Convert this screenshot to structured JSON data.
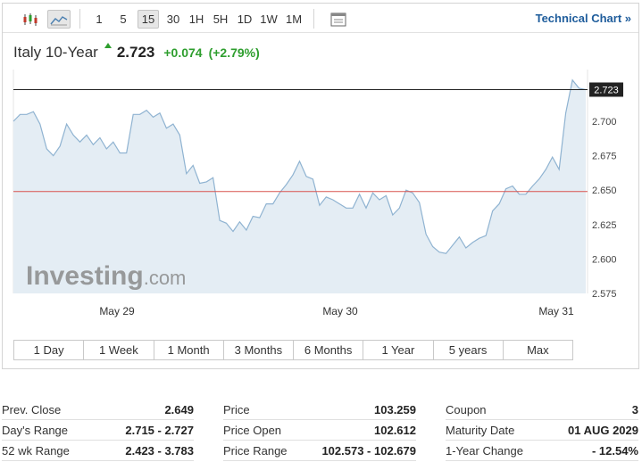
{
  "toolbar": {
    "periods": [
      "1",
      "5",
      "15",
      "30",
      "1H",
      "5H",
      "1D",
      "1W",
      "1M"
    ],
    "active_period": "15",
    "technical_chart": "Technical Chart »"
  },
  "instrument": {
    "name": "Italy 10-Year",
    "last": "2.723",
    "change": "+0.074",
    "change_pct": "(+2.79%)"
  },
  "watermark": {
    "brand": "Investing",
    "suffix": ".com"
  },
  "chart_data": {
    "type": "area",
    "y_ticks": [
      "2.700",
      "2.675",
      "2.650",
      "2.625",
      "2.600",
      "2.575"
    ],
    "y_range": [
      2.575,
      2.725
    ],
    "x_labels": [
      "May 29",
      "May 30",
      "May 31"
    ],
    "current_value": 2.723,
    "current_label": "2.723",
    "prev_close": 2.649,
    "series": [
      {
        "values": [
          2.7,
          2.705,
          2.705,
          2.707,
          2.698,
          2.68,
          2.675,
          2.682,
          2.698,
          2.69,
          2.685,
          2.69,
          2.683,
          2.688,
          2.68,
          2.685,
          2.677,
          2.677,
          2.705,
          2.705,
          2.708,
          2.703,
          2.706,
          2.695,
          2.698,
          2.69,
          2.662,
          2.668,
          2.655,
          2.656,
          2.659,
          2.628,
          2.626,
          2.62,
          2.627,
          2.621,
          2.631,
          2.63,
          2.64,
          2.64,
          2.648,
          2.654,
          2.661,
          2.671,
          2.66,
          2.658,
          2.639,
          2.645,
          2.643,
          2.64,
          2.637,
          2.637,
          2.647,
          2.637,
          2.648,
          2.643,
          2.646,
          2.632,
          2.637,
          2.65,
          2.648,
          2.641,
          2.618,
          2.609,
          2.605,
          2.604,
          2.61,
          2.616,
          2.608,
          2.612,
          2.615,
          2.617,
          2.635,
          2.64,
          2.651,
          2.653,
          2.647,
          2.647,
          2.653,
          2.658,
          2.665,
          2.674,
          2.665,
          2.706,
          2.73,
          2.724,
          2.723
        ]
      }
    ]
  },
  "stats": {
    "col1": [
      {
        "label": "Prev. Close",
        "value": "2.649"
      },
      {
        "label": "Day's Range",
        "value": "2.715 - 2.727"
      },
      {
        "label": "52 wk Range",
        "value": "2.423 - 3.783"
      }
    ],
    "col2": [
      {
        "label": "Price",
        "value": "103.259"
      },
      {
        "label": "Price Open",
        "value": "102.612"
      },
      {
        "label": "Price Range",
        "value": "102.573 - 102.679"
      }
    ],
    "col3": [
      {
        "label": "Coupon",
        "value": "3"
      },
      {
        "label": "Maturity Date",
        "value": "01 AUG 2029"
      },
      {
        "label": "1-Year Change",
        "value": "- 12.54%"
      }
    ]
  },
  "ranges": [
    "1 Day",
    "1 Week",
    "1 Month",
    "3 Months",
    "6 Months",
    "1 Year",
    "5 years",
    "Max"
  ],
  "colors": {
    "up": "#2e9e2e",
    "link": "#1f5d9c",
    "prev_close_line": "#d9534f",
    "area_fill": "#e4edf4",
    "area_stroke": "#8fb3d1"
  }
}
